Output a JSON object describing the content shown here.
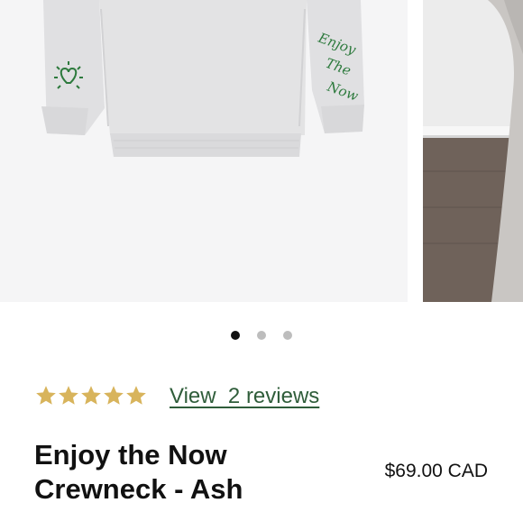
{
  "gallery": {
    "main_image": "sweatshirt-ash-product-image",
    "next_image": "model-photo-partial",
    "sleeve_text": [
      "Enjoy",
      "The",
      "Now"
    ],
    "cuff_logo": "heart-logo",
    "dots_total": 3,
    "active_dot": 1
  },
  "rating": {
    "stars": 5,
    "star_color": "#d8b45c",
    "link_text": "View  2 reviews",
    "link_color": "#2f5d3a"
  },
  "product": {
    "title_line1": "Enjoy the Now",
    "title_line2": "Crewneck - Ash",
    "price": "$69.00 CAD"
  }
}
